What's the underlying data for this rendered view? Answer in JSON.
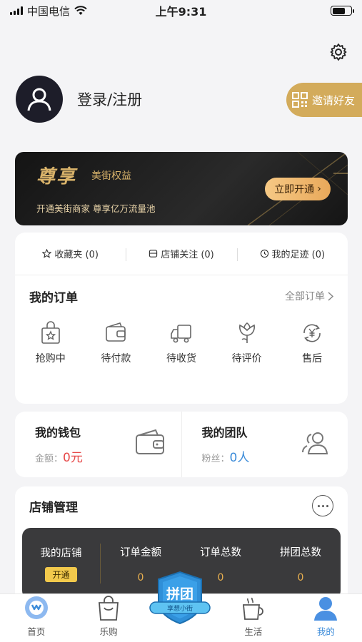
{
  "status_bar": {
    "carrier": "中国电信",
    "time": "上午9:31"
  },
  "profile": {
    "login_label": "登录/注册",
    "invite_label": "邀请好友"
  },
  "vip": {
    "title": "尊享",
    "subtitle": "美街权益",
    "desc": "开通美街商家 尊享亿万流量池",
    "button": "立即开通",
    "accent": "#d9b36a"
  },
  "quick_links": [
    {
      "label": "收藏夹 (0)",
      "icon": "star-icon"
    },
    {
      "label": "店铺关注 (0)",
      "icon": "shop-icon"
    },
    {
      "label": "我的足迹 (0)",
      "icon": "clock-icon"
    }
  ],
  "orders": {
    "title": "我的订单",
    "all_label": "全部订单",
    "items": [
      {
        "label": "抢购中",
        "icon": "bag-star-icon"
      },
      {
        "label": "待付款",
        "icon": "wallet-icon"
      },
      {
        "label": "待收货",
        "icon": "truck-icon"
      },
      {
        "label": "待评价",
        "icon": "flower-icon"
      },
      {
        "label": "售后",
        "icon": "yuan-refresh-icon"
      }
    ]
  },
  "wallet": {
    "title": "我的钱包",
    "amount_label": "金额：",
    "amount_value": "0元"
  },
  "team": {
    "title": "我的团队",
    "fans_label": "粉丝：",
    "fans_value": "0人"
  },
  "shop": {
    "title": "店铺管理",
    "my_shop_label": "我的店铺",
    "open_label": "开通",
    "stats": [
      {
        "label": "订单金额",
        "value": "0"
      },
      {
        "label": "订单总数",
        "value": "0"
      },
      {
        "label": "拼团总数",
        "value": "0"
      }
    ]
  },
  "tabbar": {
    "items": [
      {
        "label": "首页",
        "icon": "home-logo-icon",
        "active": false
      },
      {
        "label": "乐购",
        "icon": "shopping-bag-icon",
        "active": false
      },
      {
        "label": "",
        "icon": "group-buy-badge-icon",
        "active": false
      },
      {
        "label": "生活",
        "icon": "coffee-cup-icon",
        "active": false
      },
      {
        "label": "我的",
        "icon": "person-icon",
        "active": true
      }
    ],
    "center_badge_text": "拼团",
    "center_badge_sub": "享想小街",
    "active_color": "#3d8cd9"
  }
}
